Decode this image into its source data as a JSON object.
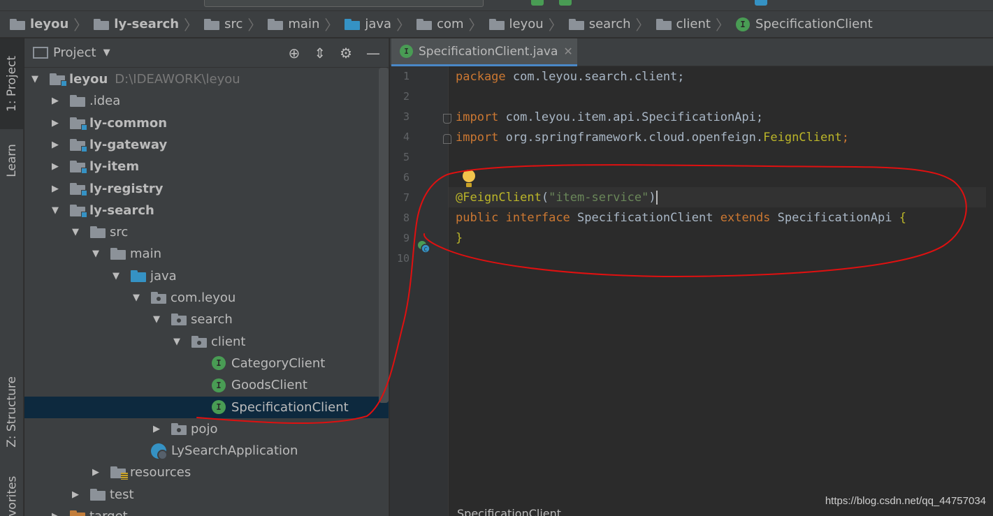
{
  "breadcrumb": [
    {
      "label": "leyou",
      "bold": true,
      "icon": "module-folder-icon"
    },
    {
      "label": "ly-search",
      "bold": true,
      "icon": "module-folder-icon"
    },
    {
      "label": "src",
      "icon": "folder-icon"
    },
    {
      "label": "main",
      "icon": "folder-icon"
    },
    {
      "label": "java",
      "icon": "source-folder-icon"
    },
    {
      "label": "com",
      "icon": "package-icon"
    },
    {
      "label": "leyou",
      "icon": "package-icon"
    },
    {
      "label": "search",
      "icon": "package-icon"
    },
    {
      "label": "client",
      "icon": "package-icon"
    },
    {
      "label": "SpecificationClient",
      "icon": "interface-icon"
    }
  ],
  "stripe": {
    "project_tab": "1: Project",
    "learn_tab": "Learn",
    "structure_tab": "Z: Structure",
    "favorites_tab": "Favorites"
  },
  "project_panel": {
    "title": "Project",
    "tree": [
      {
        "label": "leyou",
        "path": "D:\\IDEAWORK\\leyou",
        "bold": true,
        "expanded": true
      },
      {
        "label": ".idea",
        "expanded": false
      },
      {
        "label": "ly-common",
        "bold": true,
        "expanded": false
      },
      {
        "label": "ly-gateway",
        "bold": true,
        "expanded": false
      },
      {
        "label": "ly-item",
        "bold": true,
        "expanded": false
      },
      {
        "label": "ly-registry",
        "bold": true,
        "expanded": false
      },
      {
        "label": "ly-search",
        "bold": true,
        "expanded": true
      },
      {
        "label": "src",
        "expanded": true
      },
      {
        "label": "main",
        "expanded": true
      },
      {
        "label": "java",
        "expanded": true
      },
      {
        "label": "com.leyou",
        "expanded": true
      },
      {
        "label": "search",
        "expanded": true
      },
      {
        "label": "client",
        "expanded": true
      },
      {
        "label": "CategoryClient",
        "type": "interface"
      },
      {
        "label": "GoodsClient",
        "type": "interface"
      },
      {
        "label": "SpecificationClient",
        "type": "interface",
        "selected": true
      },
      {
        "label": "pojo",
        "expanded": false
      },
      {
        "label": "LySearchApplication",
        "type": "app"
      },
      {
        "label": "resources",
        "expanded": false
      },
      {
        "label": "test",
        "expanded": false
      },
      {
        "label": "target",
        "expanded": false
      }
    ]
  },
  "editor": {
    "tab_label": "SpecificationClient.java",
    "tab_icon_letter": "I",
    "line_numbers": [
      "1",
      "2",
      "3",
      "4",
      "5",
      "6",
      "7",
      "8",
      "9",
      "10"
    ],
    "code": {
      "l1_kw": "package",
      "l1_rest": " com.leyou.search.client;",
      "l3_kw": "import",
      "l3_rest": " com.leyou.item.api.SpecificationApi;",
      "l4_kw": "import",
      "l4_rest": " org.springframework.cloud.openfeign.",
      "l4_cls": "FeignClient",
      "l4_end": ";",
      "l7_ann": "@FeignClient",
      "l7_open": "(",
      "l7_str": "\"item-service\"",
      "l7_close": ")",
      "l8_kw1": "public",
      "l8_kw2": "interface",
      "l8_name": "SpecificationClient",
      "l8_kw3": "extends",
      "l8_super": "SpecificationApi",
      "l8_brace": "{",
      "l9_brace": "}"
    },
    "bottom_breadcrumb": "SpecificationClient"
  },
  "watermark": "https://blog.csdn.net/qq_44757034",
  "colors": {
    "keyword": "#cc7832",
    "annotation": "#bbb529",
    "string": "#6a8759",
    "selection": "#0d293e",
    "annotation_stroke": "#e01010"
  }
}
